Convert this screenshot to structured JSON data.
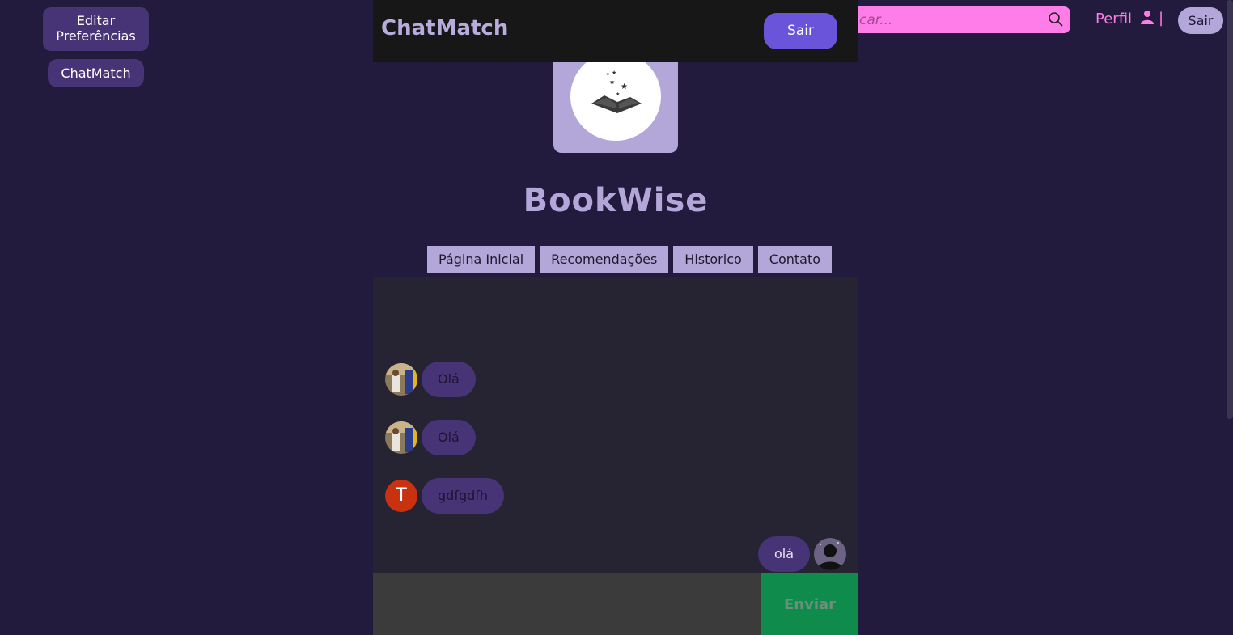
{
  "sidebar": {
    "edit_prefs_line1": "Editar",
    "edit_prefs_line2": "Preferências",
    "chatmatch": "ChatMatch"
  },
  "navbar": {
    "search_placeholder": "car...",
    "perfil": "Perfil",
    "separator": "|",
    "sair": "Sair"
  },
  "chat_header": {
    "title": "ChatMatch",
    "sair": "Sair"
  },
  "brand": "BookWise",
  "menu": [
    "Página Inicial",
    "Recomendações",
    "Historico",
    "Contato"
  ],
  "messages": [
    {
      "side": "left",
      "avatar": "photo",
      "text": "Olá"
    },
    {
      "side": "left",
      "avatar": "photo",
      "text": "Olá"
    },
    {
      "side": "left",
      "avatar": "letter",
      "letter": "T",
      "text": "gdfgdfh"
    },
    {
      "side": "right",
      "avatar": "silhouette",
      "text": "olá"
    }
  ],
  "send_label": "Enviar",
  "colors": {
    "background": "#221b3d",
    "accent_pink": "#ff7de8",
    "lavender": "#b2a7d8",
    "bubble": "#473477",
    "send_green": "#0f8c4c"
  }
}
